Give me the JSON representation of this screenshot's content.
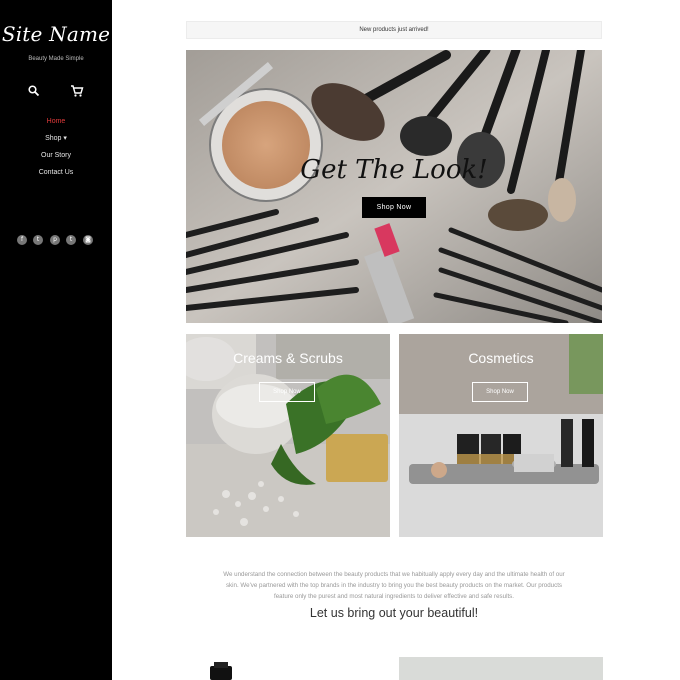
{
  "sidebar": {
    "site_name": "Site Name",
    "tagline": "Beauty Made Simple",
    "icons": [
      "search-icon",
      "cart-icon"
    ],
    "nav": [
      {
        "label": "Home",
        "active": true
      },
      {
        "label": "Shop ▾",
        "active": false
      },
      {
        "label": "Our Story",
        "active": false
      },
      {
        "label": "Contact Us",
        "active": false
      }
    ],
    "social": [
      {
        "name": "facebook-icon",
        "glyph": "f"
      },
      {
        "name": "twitter-icon",
        "glyph": "t"
      },
      {
        "name": "pinterest-icon",
        "glyph": "p"
      },
      {
        "name": "tumblr-icon",
        "glyph": "t"
      },
      {
        "name": "instagram-icon",
        "glyph": "◙"
      }
    ]
  },
  "announcement": "New products just arrived!",
  "hero": {
    "title": "Get The Look!",
    "button": "Shop Now"
  },
  "tiles": [
    {
      "title": "Creams & Scrubs",
      "button": "Shop Now"
    },
    {
      "title": "Cosmetics",
      "button": "Shop Now"
    }
  ],
  "about_text": "We understand the connection between the beauty products that we habitually apply every day and the ultimate health of our skin. We've partnered with the top brands in the industry to bring you the best beauty products on the market. Our products feature only the purest and most natural ingredients to deliver effective and safe results.",
  "slogan": "Let us bring out your beautiful!",
  "colors": {
    "sidebar_bg": "#000000",
    "active_nav": "#e23b3b",
    "button_bg": "#000000"
  }
}
